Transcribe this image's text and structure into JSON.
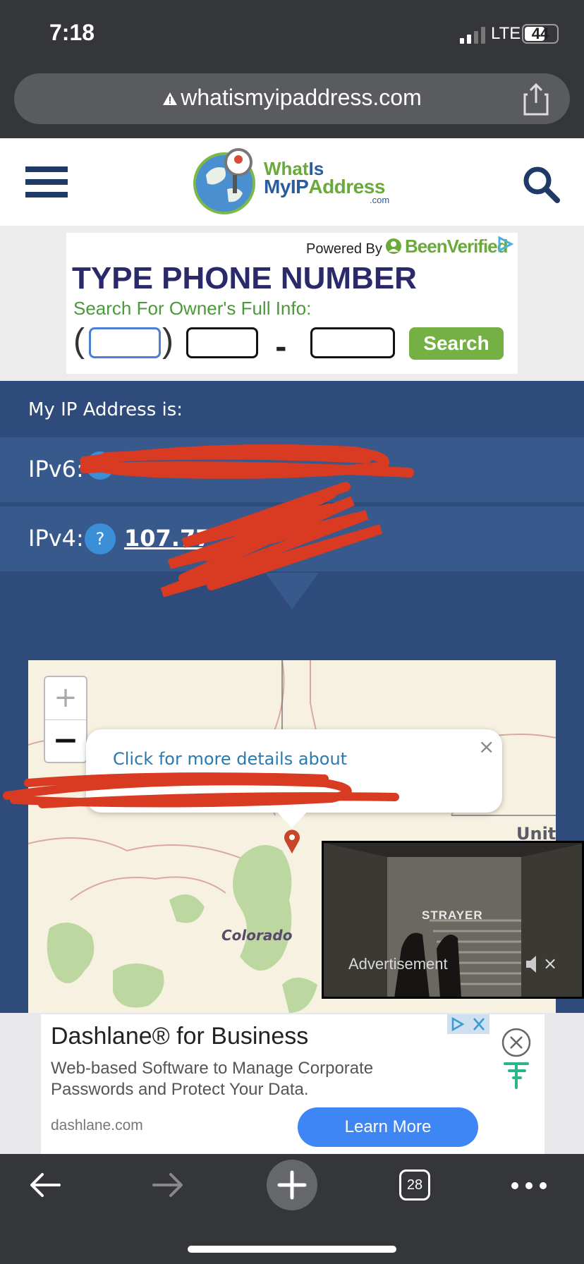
{
  "status_bar": {
    "time": "7:18",
    "network": "LTE",
    "battery": "44"
  },
  "browser": {
    "url": "whatismyipaddress.com",
    "tabs_count": "28"
  },
  "site": {
    "logo_line1_a": "What",
    "logo_line1_b": "Is",
    "logo_line2_a": "MyIP",
    "logo_line2_b": "Address",
    "logo_suffix": ".com"
  },
  "top_ad": {
    "powered_by": "Powered By",
    "brand": "BeenVerified",
    "title": "TYPE PHONE NUMBER",
    "subtitle": "Search For Owner's Full Info:",
    "paren_open": "(",
    "paren_close": ")",
    "dash": "-",
    "search_button": "Search"
  },
  "ip_section": {
    "heading": "My IP Address is:",
    "ipv6_label": "IPv6:",
    "ipv4_label": "IPv4:",
    "ipv4_value": "107.77",
    "help_glyph": "?"
  },
  "map": {
    "zoom_in": "+",
    "zoom_out": "−",
    "popup_text": "Click for more details about",
    "popup_close": "×",
    "state_label": "Colorado",
    "country_label_partial": "Unit"
  },
  "video_ad": {
    "brand": "STRAYER",
    "label": "Advertisement",
    "close": "×"
  },
  "bottom_ad": {
    "title": "Dashlane® for Business",
    "description": "Web-based Software to Manage Corporate Passwords and Protect Your Data.",
    "domain": "dashlane.com",
    "cta": "Learn More"
  },
  "colors": {
    "ip_background": "#2f4b7c",
    "ip_row": "#38598c",
    "brand_blue": "#2b5c9e",
    "brand_green": "#6aaa3a",
    "cta_blue": "#3d86f4",
    "redaction": "#d93a22"
  }
}
